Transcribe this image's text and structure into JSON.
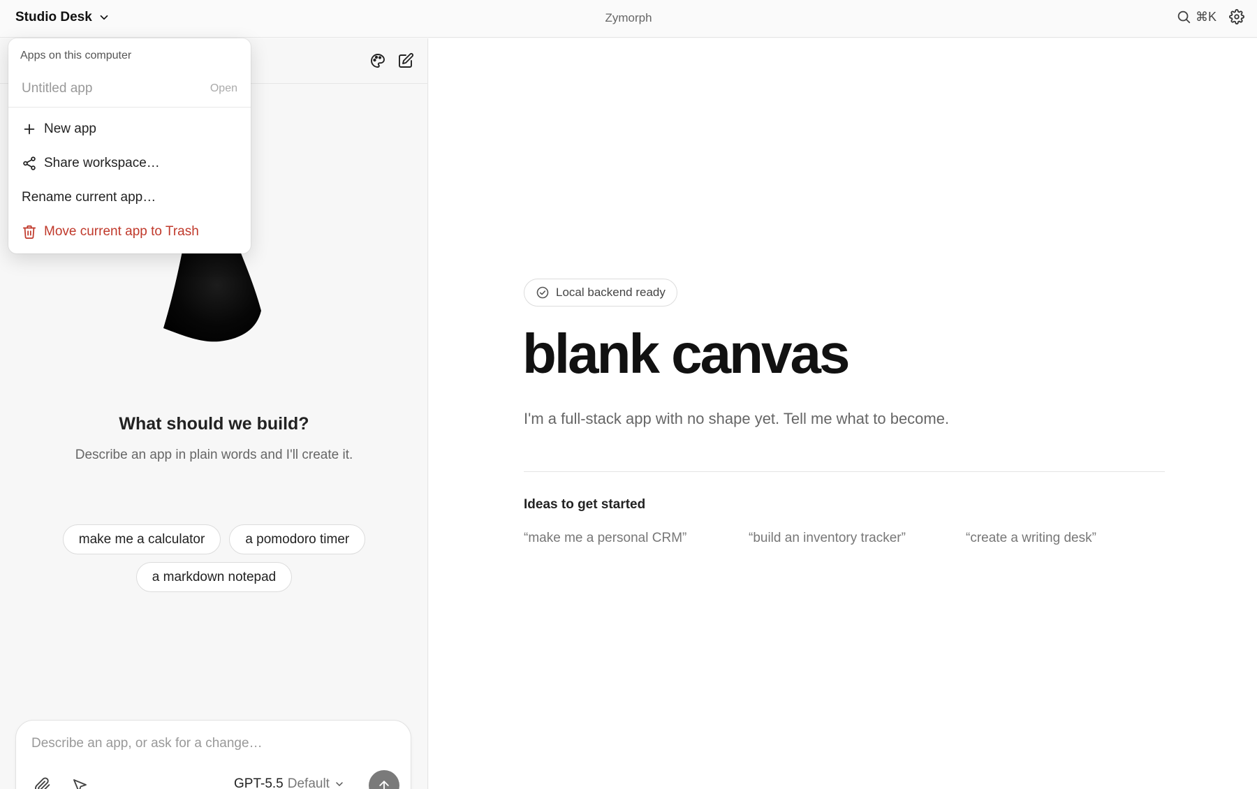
{
  "topbar": {
    "workspace_name": "Studio Desk",
    "app_title": "Zymorph",
    "search_shortcut": "⌘K"
  },
  "menu": {
    "header": "Apps on this computer",
    "apps": [
      {
        "name": "Untitled app",
        "status": "Open"
      }
    ],
    "new_app": "New app",
    "share_workspace": "Share workspace…",
    "rename_app": "Rename current app…",
    "trash_app": "Move current app to Trash"
  },
  "chat": {
    "title": "What should we build?",
    "subtitle": "Describe an app in plain words and I'll create it.",
    "suggestions": [
      "make me a calculator",
      "a pomodoro timer",
      "a markdown notepad"
    ],
    "composer_placeholder": "Describe an app, or ask for a change…",
    "model_name": "GPT-5.5",
    "model_variant": "Default"
  },
  "canvas": {
    "status_badge": "Local backend ready",
    "title": "blank canvas",
    "subtitle": "I'm a full-stack app with no shape yet. Tell me what to become.",
    "ideas_title": "Ideas to get started",
    "ideas": [
      "“make me a personal CRM”",
      "“build an inventory tracker”",
      "“create a writing desk”"
    ]
  },
  "colors": {
    "danger": "#c0392b",
    "send_button": "#7a7a7a",
    "muted_text": "#777777"
  },
  "icons": {
    "workspace_dropdown": "chevron-down-icon",
    "search": "search-icon",
    "settings": "gear-icon",
    "theme": "palette-icon",
    "new_chat": "edit-icon",
    "new_app": "plus-icon",
    "share": "share-icon",
    "trash": "trash-icon",
    "attach": "paperclip-icon",
    "select": "cursor-icon",
    "send": "arrow-up-icon",
    "status": "check-circle-icon"
  }
}
